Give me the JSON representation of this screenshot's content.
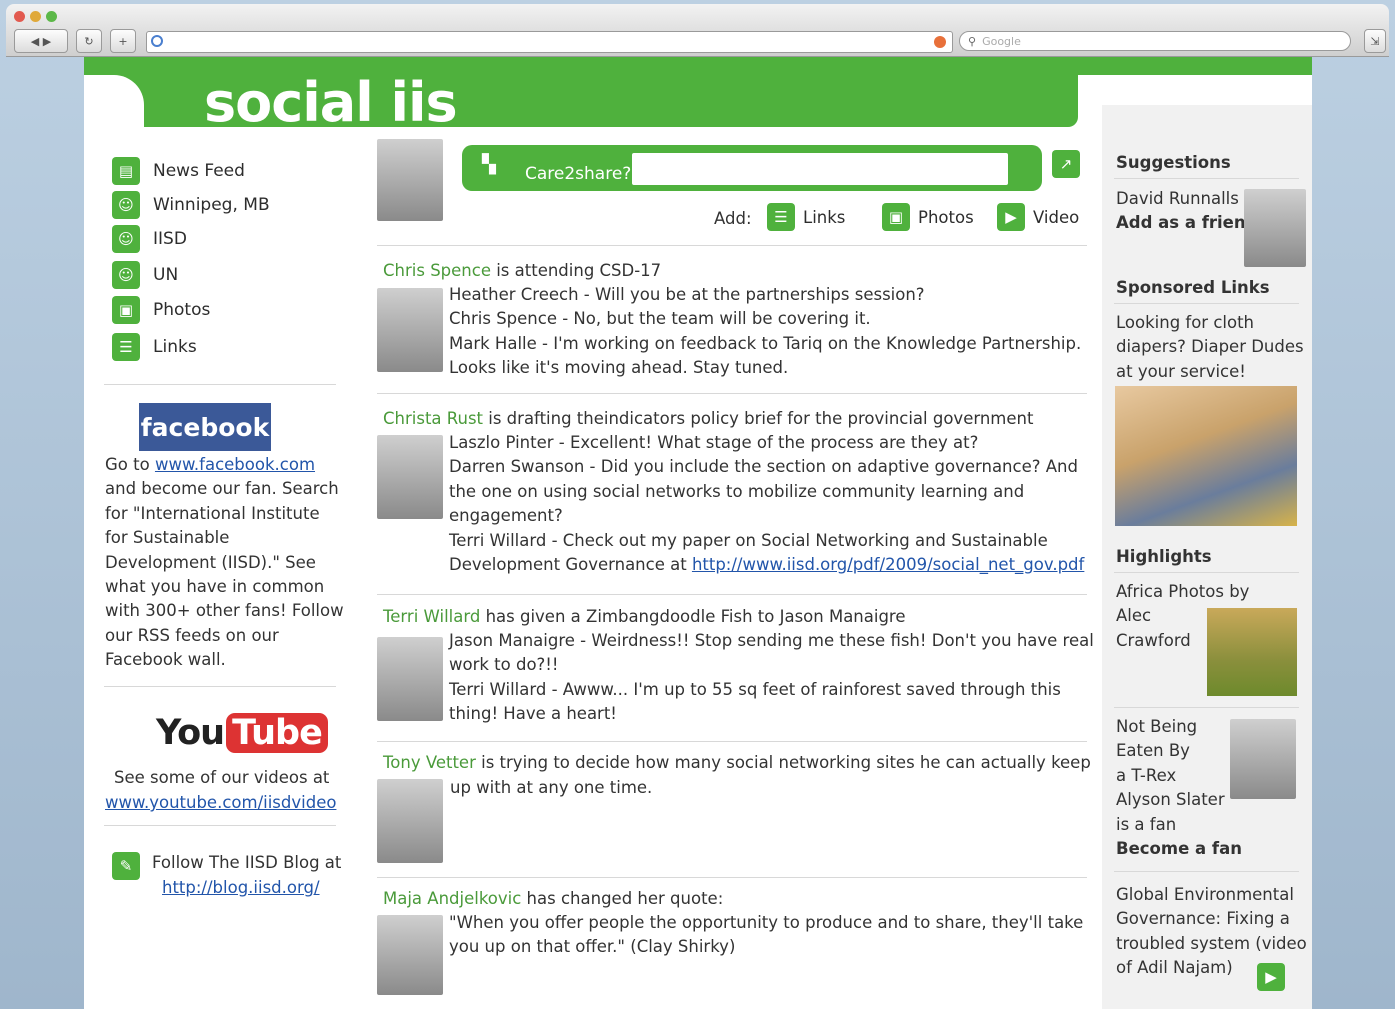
{
  "browser": {
    "search_placeholder": "Google"
  },
  "brand": {
    "logo": "social iis",
    "accent": "#4fb13d"
  },
  "share": {
    "prompt": "Care2share?",
    "add_label": "Add:",
    "links": "Links",
    "photos": "Photos",
    "video": "Video"
  },
  "nav": {
    "items": [
      {
        "label": "News Feed",
        "icon": "news-feed-icon"
      },
      {
        "label": "Winnipeg, MB",
        "icon": "person-icon"
      },
      {
        "label": "IISD",
        "icon": "person-icon"
      },
      {
        "label": "UN",
        "icon": "person-icon"
      },
      {
        "label": "Photos",
        "icon": "photo-icon"
      },
      {
        "label": "Links",
        "icon": "links-icon"
      }
    ]
  },
  "facebook": {
    "logo": "facebook",
    "go_to": "Go to",
    "url": "www.facebook.com",
    "lines": [
      "and become our fan. Search",
      "for \"International Institute",
      "for Sustainable",
      "Development (IISD).\" See",
      "what you have in common",
      "with 300+ other fans! Follow",
      "our RSS feeds on our",
      "Facebook wall."
    ]
  },
  "youtube": {
    "logo_you": "You",
    "logo_tube": "Tube",
    "text": "See some of our videos at",
    "url": "www.youtube.com/iisdvideo"
  },
  "blog": {
    "text": "Follow The IISD Blog at",
    "url": "http://blog.iisd.org/"
  },
  "feed": [
    {
      "author": "Chris Spence",
      "action": " is attending CSD-17",
      "comments": [
        {
          "name": "Heather Creech",
          "text": "Will you be at the partnerships session?"
        },
        {
          "name": "Chris Spence",
          "text": "No, but the team will be covering it."
        },
        {
          "name": "Mark Halle",
          "text": "I'm working on feedback to Tariq on the Knowledge Partnership."
        }
      ],
      "extra": "Looks like it's moving ahead. Stay tuned."
    },
    {
      "author": "Christa Rust",
      "action": " is drafting theindicators policy brief for the provincial government",
      "comments": [
        {
          "name": "Laszlo Pinter",
          "text": "Excellent! What stage of the process are they at?"
        },
        {
          "name": "Darren Swanson",
          "text": "Did you include the section on adaptive governance? And"
        }
      ],
      "lines": [
        "the one on using social networks to mobilize community learning and",
        "engagement?"
      ],
      "last_name": "Terri Willard",
      "last_text": "Check out my paper on Social Networking and Sustainable",
      "last_line2": "Development Governance at ",
      "link": "http://www.iisd.org/pdf/2009/social_net_gov.pdf"
    },
    {
      "author": "Terri Willard",
      "action": " has given a Zimbangdoodle Fish to Jason Manaigre",
      "comments": [
        {
          "name": "Jason Manaigre",
          "text": "Weirdness!! Stop sending me these fish! Don't you have real"
        }
      ],
      "line_a": "work to do?!!",
      "c2_name": "Terri Willard",
      "c2_text": "Awww... I'm up to 55 sq feet of rainforest saved through this",
      "line_b": "thing! Have a heart!"
    },
    {
      "author": "Tony Vetter",
      "action": " is trying to decide how many social networking sites he can actually keep",
      "line2": "up with at any one time."
    },
    {
      "author": "Maja Andjelkovic",
      "action": " has changed her quote:",
      "quote1": "\"When you offer people the opportunity to produce and to share, they'll take",
      "quote2": "you up on that offer.\" (Clay Shirky)"
    }
  ],
  "right": {
    "suggestions_title": "Suggestions",
    "suggestion_name": "David Runnalls",
    "add_friend": "Add as a friend",
    "sponsored_title": "Sponsored Links",
    "ad_lines": [
      "Looking for cloth",
      "diapers? Diaper Dudes",
      "at your service!"
    ],
    "highlights_title": "Highlights",
    "highlight_lines": [
      "Africa Photos by",
      "Alec",
      "Crawford"
    ],
    "fan_lines": [
      "Not Being",
      "Eaten By",
      "a T-Rex",
      "Alyson Slater",
      "is a fan"
    ],
    "become_fan": "Become a fan",
    "video_lines": [
      "Global Environmental",
      "Governance: Fixing a",
      "troubled system (video",
      "of Adil Najam)"
    ]
  }
}
